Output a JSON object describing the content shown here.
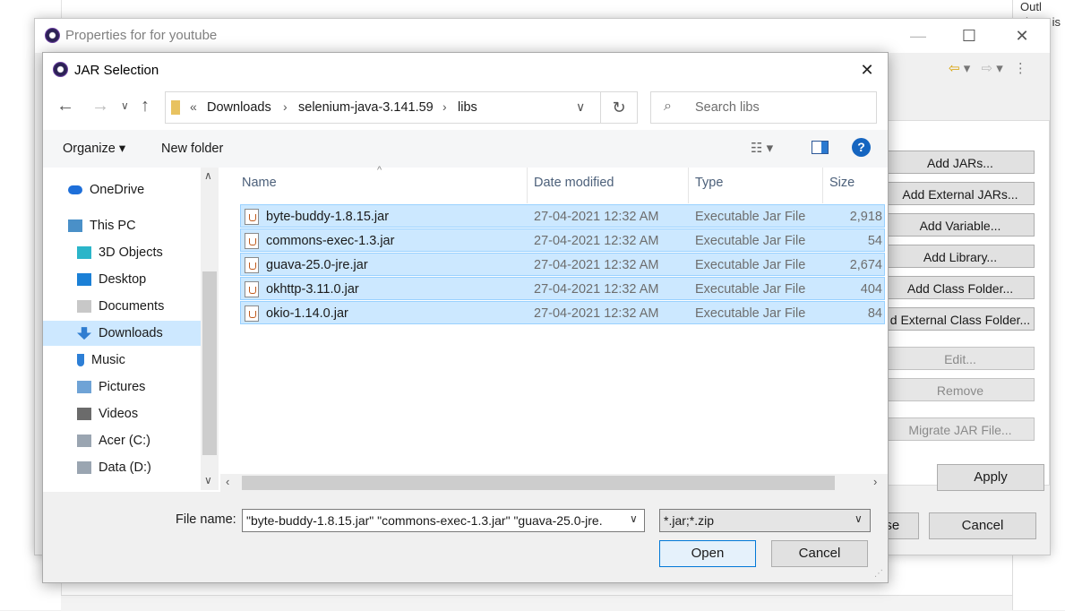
{
  "background": {
    "right_panel_text": "There is",
    "top_right_text": "Outl"
  },
  "properties": {
    "title": "Properties for for youtube",
    "buttons": [
      {
        "label": "Add JARs...",
        "enabled": true
      },
      {
        "label": "Add External JARs...",
        "enabled": true
      },
      {
        "label": "Add Variable...",
        "enabled": true
      },
      {
        "label": "Add Library...",
        "enabled": true
      },
      {
        "label": "Add Class Folder...",
        "enabled": true
      },
      {
        "label": "d External Class Folder...",
        "enabled": true
      },
      {
        "label": "Edit...",
        "enabled": false
      },
      {
        "label": "Remove",
        "enabled": false
      },
      {
        "label": "Migrate JAR File...",
        "enabled": false
      }
    ],
    "apply_label": "Apply",
    "close_label": "Close",
    "cancel_label": "Cancel"
  },
  "jar_dialog": {
    "title": "JAR Selection",
    "breadcrumb": {
      "prefix": "«",
      "parts": [
        "Downloads",
        "selenium-java-3.141.59",
        "libs"
      ]
    },
    "search_placeholder": "Search libs",
    "toolbar": {
      "organize": "Organize ▾",
      "new_folder": "New folder"
    },
    "nav_items": [
      {
        "label": "OneDrive",
        "icon": "onedrive-icon",
        "selected": false
      },
      {
        "label": "This PC",
        "icon": "computer-icon",
        "selected": false
      },
      {
        "label": "3D Objects",
        "icon": "cube-icon",
        "selected": false
      },
      {
        "label": "Desktop",
        "icon": "desktop-icon",
        "selected": false
      },
      {
        "label": "Documents",
        "icon": "documents-icon",
        "selected": false
      },
      {
        "label": "Downloads",
        "icon": "download-arrow-icon",
        "selected": true
      },
      {
        "label": "Music",
        "icon": "music-note-icon",
        "selected": false
      },
      {
        "label": "Pictures",
        "icon": "pictures-icon",
        "selected": false
      },
      {
        "label": "Videos",
        "icon": "film-icon",
        "selected": false
      },
      {
        "label": "Acer (C:)",
        "icon": "drive-icon",
        "selected": false
      },
      {
        "label": "Data (D:)",
        "icon": "drive-icon",
        "selected": false
      }
    ],
    "columns": [
      "Name",
      "Date modified",
      "Type",
      "Size"
    ],
    "files": [
      {
        "name": "byte-buddy-1.8.15.jar",
        "date": "27-04-2021 12:32 AM",
        "type": "Executable Jar File",
        "size": "2,918"
      },
      {
        "name": "commons-exec-1.3.jar",
        "date": "27-04-2021 12:32 AM",
        "type": "Executable Jar File",
        "size": "54"
      },
      {
        "name": "guava-25.0-jre.jar",
        "date": "27-04-2021 12:32 AM",
        "type": "Executable Jar File",
        "size": "2,674"
      },
      {
        "name": "okhttp-3.11.0.jar",
        "date": "27-04-2021 12:32 AM",
        "type": "Executable Jar File",
        "size": "404"
      },
      {
        "name": "okio-1.14.0.jar",
        "date": "27-04-2021 12:32 AM",
        "type": "Executable Jar File",
        "size": "84"
      }
    ],
    "file_name_label": "File name:",
    "file_name_value": "\"byte-buddy-1.8.15.jar\" \"commons-exec-1.3.jar\" \"guava-25.0-jre.",
    "filter_value": "*.jar;*.zip",
    "open_label": "Open",
    "cancel_label": "Cancel"
  }
}
